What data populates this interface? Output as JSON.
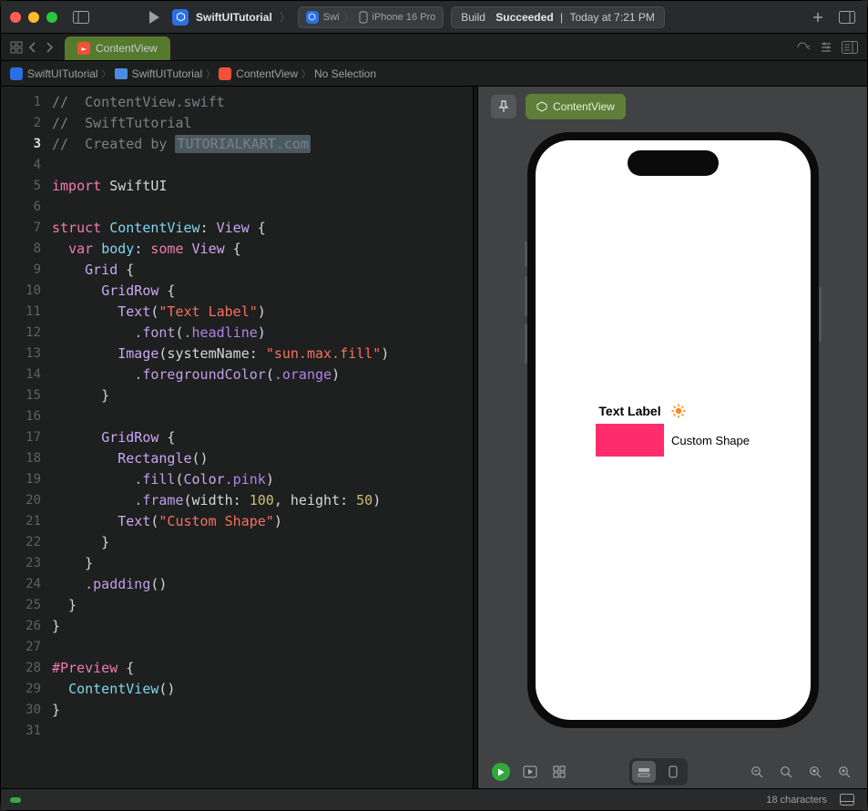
{
  "titlebar": {
    "project": "SwiftUITutorial",
    "scheme_short": "Swi",
    "device": "iPhone 16 Pro",
    "status_prefix": "Build",
    "status_result": "Succeeded",
    "status_time": "Today at 7:21 PM"
  },
  "tabs": {
    "active": "ContentView"
  },
  "breadcrumb": {
    "items": [
      "SwiftUITutorial",
      "SwiftUITutorial",
      "ContentView",
      "No Selection"
    ]
  },
  "editor": {
    "current_line": 3,
    "line_count": 31,
    "code": {
      "l1": "//  ContentView.swift",
      "l2": "//  SwiftTutorial",
      "l3_prefix": "//  Created by ",
      "l3_hl": "TUTORIALKART.com",
      "l5_import": "import",
      "l5_mod": "SwiftUI",
      "l7_struct": "struct",
      "l7_name": "ContentView",
      "l7_proto": "View",
      "l8_var": "var",
      "l8_body": "body",
      "l8_some": "some",
      "l8_view": "View",
      "grid": "Grid",
      "gridrow": "GridRow",
      "text": "Text",
      "text_label": "\"Text Label\"",
      "font": ".font",
      "headline": ".headline",
      "image": "Image",
      "systemName": "systemName",
      "sun": "\"sun.max.fill\"",
      "fgColor": ".foregroundColor",
      "orange": ".orange",
      "rect": "Rectangle",
      "fill": ".fill",
      "color": "Color",
      "pink": ".pink",
      "frame": ".frame",
      "width_lbl": "width",
      "width_val": "100",
      "height_lbl": "height",
      "height_val": "50",
      "custom": "\"Custom Shape\"",
      "padding": ".padding",
      "preview_macro": "#Preview",
      "contentview_call": "ContentView"
    }
  },
  "preview": {
    "chip": "ContentView",
    "text_label": "Text Label",
    "custom_shape": "Custom Shape",
    "rect_fill": "#fe2b6d",
    "rect_w": 100,
    "rect_h": 50,
    "sun_color": "#fd8b1d"
  },
  "statusbar": {
    "characters": "18 characters"
  }
}
